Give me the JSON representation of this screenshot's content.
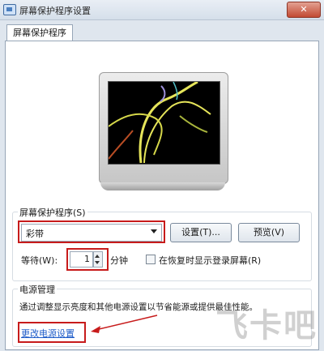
{
  "window": {
    "title": "屏幕保护程序设置",
    "close_glyph": "✕"
  },
  "tabs": [
    {
      "label": "屏幕保护程序"
    }
  ],
  "screensaver_group": {
    "label": "屏幕保护程序(S)",
    "selected": "彩带",
    "settings_button": "设置(T)...",
    "preview_button": "预览(V)",
    "wait_label": "等待(W):",
    "wait_value": "1",
    "wait_unit": "分钟",
    "resume_checkbox_label": "在恢复时显示登录屏幕(R)",
    "resume_checked": false
  },
  "power_group": {
    "label": "电源管理",
    "description": "通过调整显示亮度和其他电源设置以节省能源或提供最佳性能。",
    "change_link": "更改电源设置"
  },
  "watermark": "飞卡吧",
  "colors": {
    "highlight_red": "#c71b1b",
    "link_blue": "#1e5cc9"
  }
}
